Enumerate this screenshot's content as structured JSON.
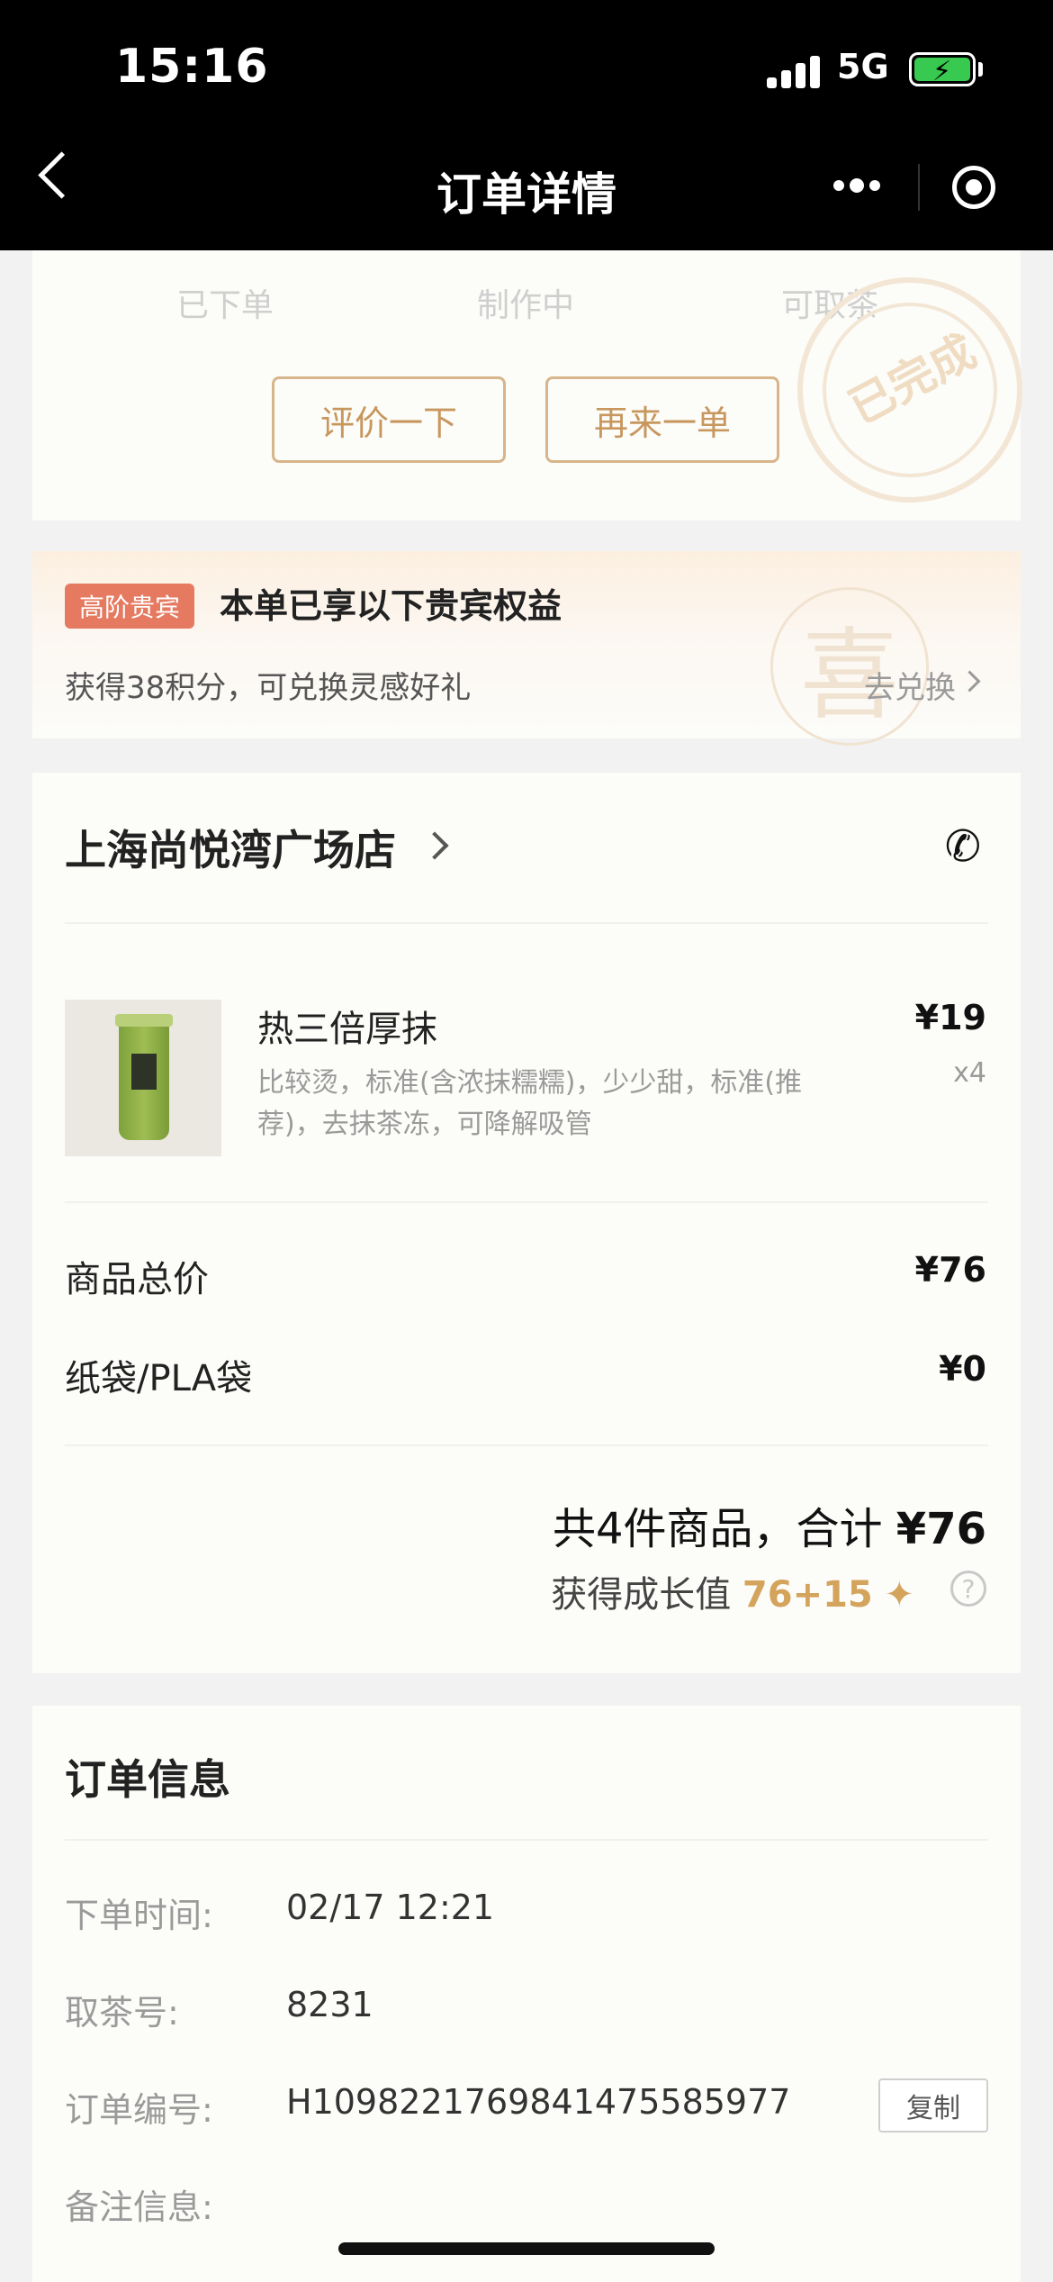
{
  "status_bar": {
    "time": "15:16",
    "network": "5G"
  },
  "nav": {
    "title": "订单详情"
  },
  "progress": {
    "steps": [
      "已下单",
      "制作中",
      "可取茶"
    ],
    "buttons": {
      "review": "评价一下",
      "reorder": "再来一单"
    },
    "stamp_text": "已完成"
  },
  "vip": {
    "badge": "高阶贵宾",
    "title": "本单已享以下贵宾权益",
    "points_text": "获得38积分，可兑换灵感好礼",
    "redeem_link": "去兑换",
    "watermark": "喜"
  },
  "order": {
    "store_name": "上海尚悦湾广场店",
    "item": {
      "name": "热三倍厚抹",
      "options": "比较烫，标准(含浓抹糯糯)，少少甜，标准(推荐)，去抹茶冻，可降解吸管",
      "price": "¥19",
      "qty": "x4"
    },
    "subtotal_label": "商品总价",
    "subtotal_value": "¥76",
    "bag_label": "纸袋/PLA袋",
    "bag_value": "¥0",
    "total_prefix": "共4件商品，合计",
    "total_value": "¥76",
    "growth_label": "获得成长值",
    "growth_value": "76+15",
    "help_glyph": "?"
  },
  "info": {
    "title": "订单信息",
    "rows": [
      {
        "label": "下单时间:",
        "value": "02/17 12:21"
      },
      {
        "label": "取茶号:",
        "value": "8231"
      },
      {
        "label": "订单编号:",
        "value": "H1098221769841475585977"
      },
      {
        "label": "备注信息:",
        "value": ""
      }
    ],
    "copy_label": "复制"
  },
  "colors": {
    "accent": "#c8975e",
    "badge": "#e57a60",
    "growth": "#d4a35c",
    "battery": "#37c950"
  }
}
